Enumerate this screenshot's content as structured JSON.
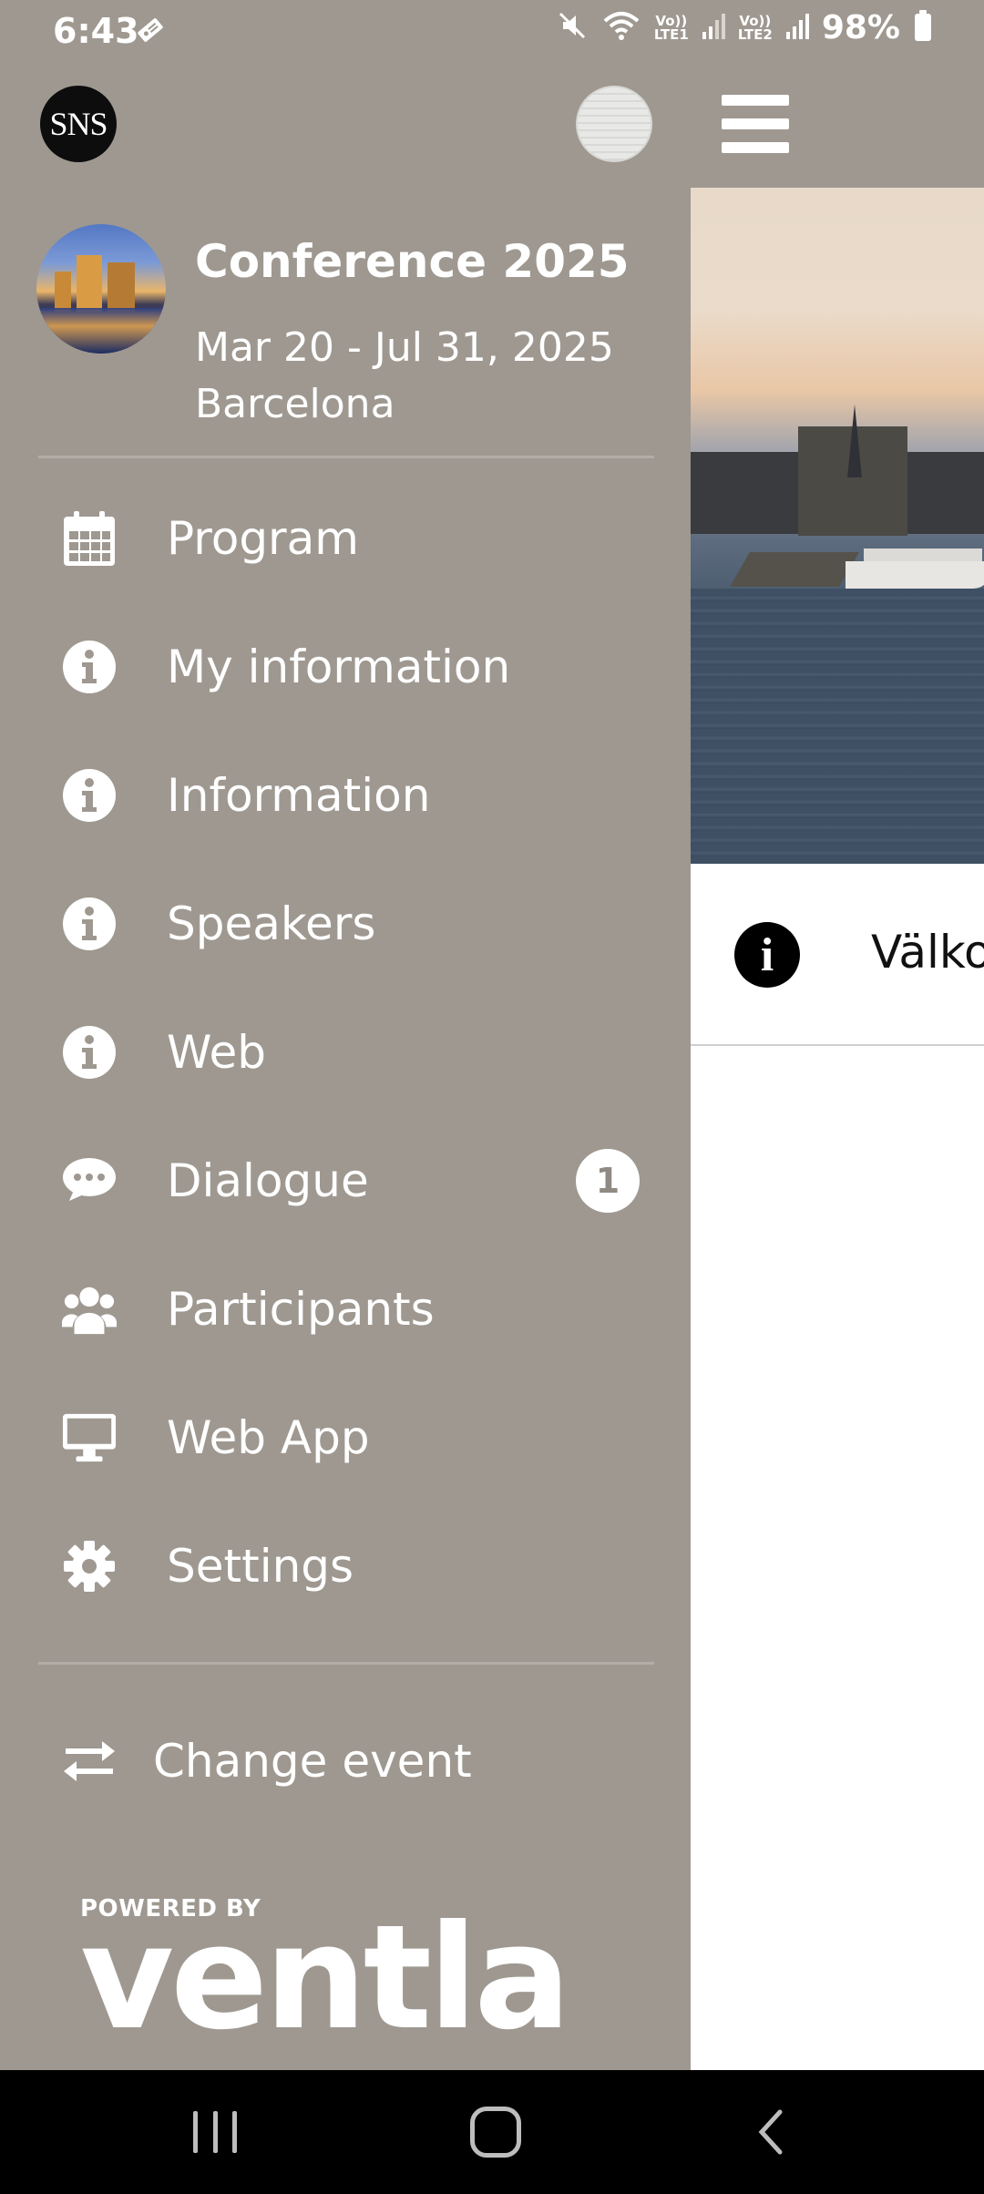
{
  "status_bar": {
    "time": "6:43",
    "net1_top": "Vo))",
    "net1_bottom": "LTE1",
    "net2_top": "Vo))",
    "net2_bottom": "LTE2",
    "battery": "98%"
  },
  "header": {
    "logo_text": "SNS"
  },
  "event": {
    "title": "Conference 2025",
    "dates": "Mar 20 - Jul 31, 2025",
    "location": "Barcelona"
  },
  "nav": {
    "items": [
      {
        "label": "Program",
        "icon": "calendar-icon"
      },
      {
        "label": "My information",
        "icon": "info-icon"
      },
      {
        "label": "Information",
        "icon": "info-icon"
      },
      {
        "label": "Speakers",
        "icon": "info-icon"
      },
      {
        "label": "Web",
        "icon": "info-icon"
      },
      {
        "label": "Dialogue",
        "icon": "chat-bubble-icon",
        "badge": "1"
      },
      {
        "label": "Participants",
        "icon": "users-icon"
      },
      {
        "label": "Web App",
        "icon": "monitor-icon"
      },
      {
        "label": "Settings",
        "icon": "gear-icon"
      }
    ],
    "change_event": "Change event"
  },
  "footer": {
    "powered_by": "POWERED BY",
    "brand": "ventla"
  },
  "content": {
    "info_text": "Välkommen"
  },
  "colors": {
    "drawer_bg": "#9e9890",
    "content_bg": "#ffffff",
    "badge_text": "#8f8a83"
  }
}
